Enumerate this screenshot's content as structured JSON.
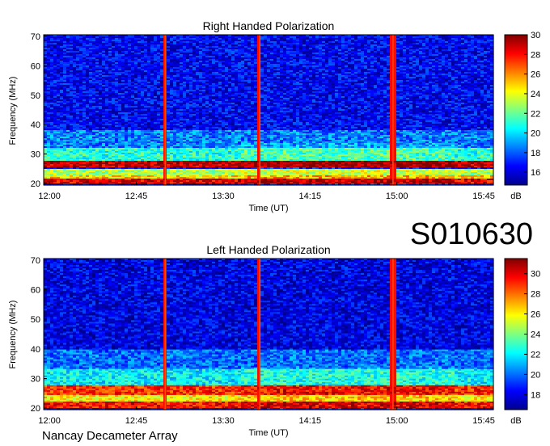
{
  "figure_id": "S010630",
  "footer": "Nancay Decameter Array",
  "chart_data": [
    {
      "type": "heatmap",
      "title": "Right Handed Polarization",
      "xlabel": "Time (UT)",
      "ylabel": "Frequency (MHz)",
      "xticks": [
        "12:00",
        "12:45",
        "13:30",
        "14:15",
        "15:00",
        "15:45"
      ],
      "xlim": [
        "11:57",
        "15:50"
      ],
      "yticks": [
        20,
        30,
        40,
        50,
        60,
        70
      ],
      "ylim": [
        19.5,
        70.5
      ],
      "colorbar": {
        "label": "dB",
        "ticks": [
          16,
          18,
          20,
          22,
          24,
          26,
          28,
          30
        ],
        "range": [
          14.7,
          30
        ],
        "colormap": "jet"
      },
      "background_level_db": 16.5,
      "emission_bands": [
        {
          "f_low": 20,
          "f_high": 21.5,
          "level_db": 28.5
        },
        {
          "f_low": 21.5,
          "f_high": 23,
          "level_db": 25
        },
        {
          "f_low": 23,
          "f_high": 25,
          "level_db": 23
        },
        {
          "f_low": 25.5,
          "f_high": 27.5,
          "level_db": 29
        },
        {
          "f_low": 27.5,
          "f_high": 32,
          "level_db": 21
        },
        {
          "f_low": 32,
          "f_high": 38,
          "level_db": 18.5
        }
      ],
      "vertical_interference_times": [
        "13:00",
        "13:49",
        "14:58"
      ],
      "grid": false
    },
    {
      "type": "heatmap",
      "title": "Left Handed Polarization",
      "xlabel": "Time (UT)",
      "ylabel": "Frequency (MHz)",
      "xticks": [
        "12:00",
        "12:45",
        "13:30",
        "14:15",
        "15:00",
        "15:45"
      ],
      "xlim": [
        "11:57",
        "15:50"
      ],
      "yticks": [
        20,
        30,
        40,
        50,
        60,
        70
      ],
      "ylim": [
        19.5,
        70.5
      ],
      "colorbar": {
        "label": "dB",
        "ticks": [
          18,
          20,
          22,
          24,
          26,
          28,
          30
        ],
        "range": [
          16.5,
          31.5
        ],
        "colormap": "jet"
      },
      "background_level_db": 18,
      "emission_bands": [
        {
          "f_low": 20,
          "f_high": 22.5,
          "level_db": 29.5
        },
        {
          "f_low": 22.5,
          "f_high": 24.5,
          "level_db": 26
        },
        {
          "f_low": 24.5,
          "f_high": 27.5,
          "level_db": 29
        },
        {
          "f_low": 27.5,
          "f_high": 33,
          "level_db": 22
        },
        {
          "f_low": 33,
          "f_high": 40,
          "level_db": 20
        }
      ],
      "vertical_interference_times": [
        "13:00",
        "13:49",
        "14:58"
      ],
      "grid": false
    }
  ]
}
